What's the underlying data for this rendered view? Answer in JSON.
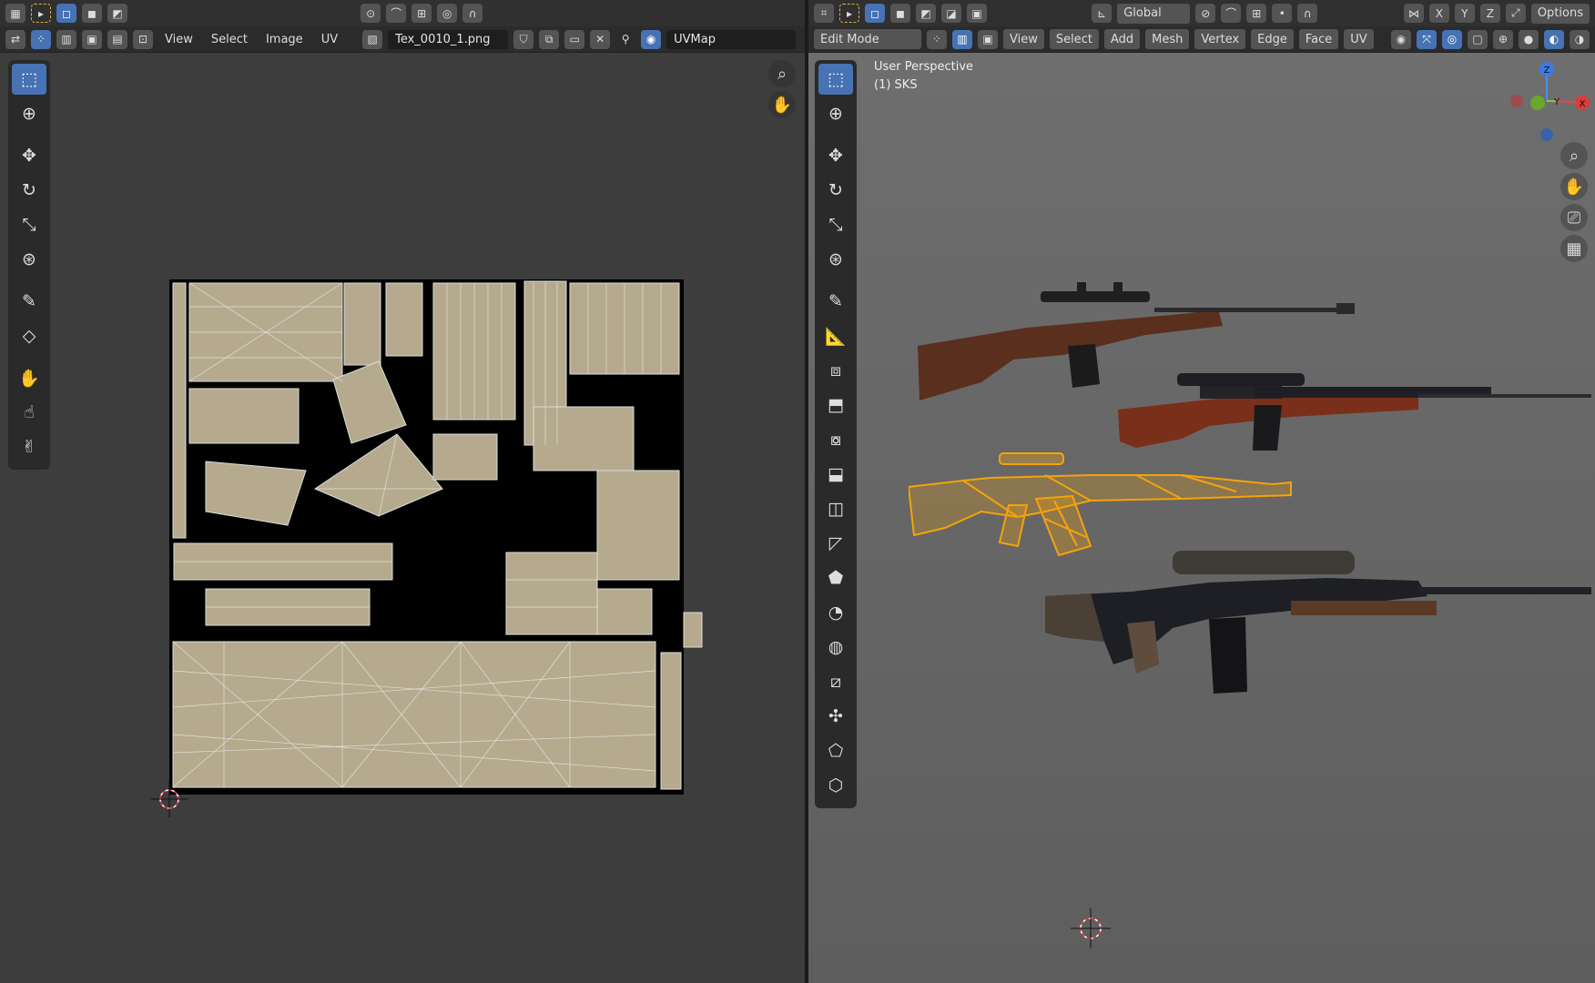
{
  "uv_editor": {
    "menus": [
      "View",
      "Select",
      "Image",
      "UV"
    ],
    "image_name": "Tex_0010_1.png",
    "uv_map": "UVMap"
  },
  "viewport": {
    "mode": "Edit Mode",
    "transform_orientation": "Global",
    "axis_x": "X",
    "axis_y": "Y",
    "axis_z": "Z",
    "options_label": "Options",
    "menus": [
      "View",
      "Select",
      "Add",
      "Mesh",
      "Vertex",
      "Edge",
      "Face",
      "UV"
    ],
    "view_name": "User Perspective",
    "object_name": "(1) SKS",
    "gizmo_labels": [
      "Z",
      "Y",
      "X"
    ]
  },
  "colors": {
    "accent": "#4772b3",
    "selected_object": "#f5a30a",
    "texture": "#b5aa8e"
  },
  "icons": {
    "uv_tools": [
      "select-box-icon",
      "cursor-icon",
      "move-icon",
      "rotate-icon",
      "scale-icon",
      "transform-icon",
      "annotate-icon",
      "rip-icon",
      "grab-icon",
      "relax-icon",
      "pinch-icon"
    ],
    "vp_tools": [
      "select-box-icon",
      "cursor-icon",
      "move-icon",
      "rotate-icon",
      "scale-icon",
      "transform-icon",
      "annotate-icon",
      "measure-icon",
      "add-cube-icon",
      "extrude-icon",
      "inset-icon",
      "bevel-icon",
      "loop-cut-icon",
      "knife-icon",
      "poly-build-icon",
      "spin-icon",
      "smooth-icon",
      "edge-slide-icon",
      "shrink-fatten-icon",
      "shear-icon",
      "rip-region-icon"
    ]
  }
}
